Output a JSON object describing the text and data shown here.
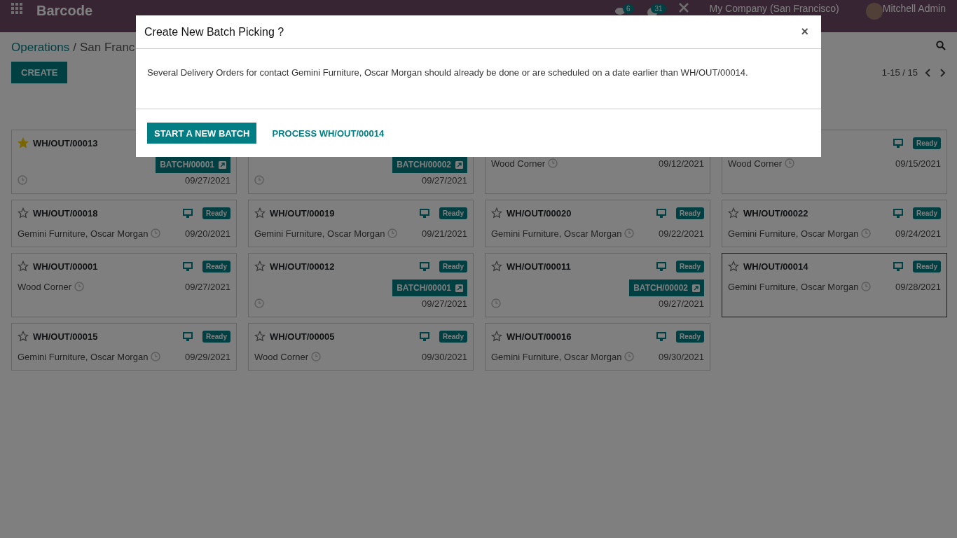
{
  "navbar": {
    "app_name": "Barcode",
    "chat_count": "6",
    "activity_count": "31",
    "company": "My Company (San Francisco)",
    "user": "Mitchell Admin"
  },
  "breadcrumb": {
    "parent": "Operations",
    "separator": "/",
    "current": "San Franc"
  },
  "create_button": "CREATE",
  "pager": "1-15 / 15",
  "cards": [
    {
      "title": "WH/OUT/00013",
      "starred": true,
      "batch": "BATCH/00001",
      "date": "09/27/2021",
      "highlighted": false
    },
    {
      "batch": "BATCH/00002",
      "date": "09/27/2021",
      "highlighted": false
    },
    {
      "partner": "Wood Corner",
      "date": "09/12/2021",
      "highlighted": false
    },
    {
      "status": "Ready",
      "partner": "Wood Corner",
      "date": "09/15/2021",
      "highlighted": false
    },
    {
      "title": "WH/OUT/00018",
      "starred": false,
      "status": "Ready",
      "partner": "Gemini Furniture, Oscar Morgan",
      "date": "09/20/2021",
      "highlighted": false
    },
    {
      "title": "WH/OUT/00019",
      "starred": false,
      "status": "Ready",
      "partner": "Gemini Furniture, Oscar Morgan",
      "date": "09/21/2021",
      "highlighted": false
    },
    {
      "title": "WH/OUT/00020",
      "starred": false,
      "status": "Ready",
      "partner": "Gemini Furniture, Oscar Morgan",
      "date": "09/22/2021",
      "highlighted": false
    },
    {
      "title": "WH/OUT/00022",
      "starred": false,
      "status": "Ready",
      "partner": "Gemini Furniture, Oscar Morgan",
      "date": "09/24/2021",
      "highlighted": false
    },
    {
      "title": "WH/OUT/00001",
      "starred": false,
      "status": "Ready",
      "partner": "Wood Corner",
      "date": "09/27/2021",
      "highlighted": false
    },
    {
      "title": "WH/OUT/00012",
      "starred": false,
      "status": "Ready",
      "batch": "BATCH/00001",
      "date": "09/27/2021",
      "highlighted": false
    },
    {
      "title": "WH/OUT/00011",
      "starred": false,
      "status": "Ready",
      "batch": "BATCH/00002",
      "date": "09/27/2021",
      "highlighted": false
    },
    {
      "title": "WH/OUT/00014",
      "starred": false,
      "status": "Ready",
      "partner": "Gemini Furniture, Oscar Morgan",
      "date": "09/28/2021",
      "highlighted": true
    },
    {
      "title": "WH/OUT/00015",
      "starred": false,
      "status": "Ready",
      "partner": "Gemini Furniture, Oscar Morgan",
      "date": "09/29/2021",
      "highlighted": false
    },
    {
      "title": "WH/OUT/00005",
      "starred": false,
      "status": "Ready",
      "partner": "Wood Corner",
      "date": "09/30/2021",
      "highlighted": false
    },
    {
      "title": "WH/OUT/00016",
      "starred": false,
      "status": "Ready",
      "partner": "Gemini Furniture, Oscar Morgan",
      "date": "09/30/2021",
      "highlighted": false
    }
  ],
  "dialog": {
    "title": "Create New Batch Picking ?",
    "close": "×",
    "message": "Several Delivery Orders for contact Gemini Furniture, Oscar Morgan should already be done or are scheduled on a date earlier than WH/OUT/00014.",
    "primary_button": "START A NEW BATCH",
    "secondary_button": "PROCESS WH/OUT/00014"
  }
}
